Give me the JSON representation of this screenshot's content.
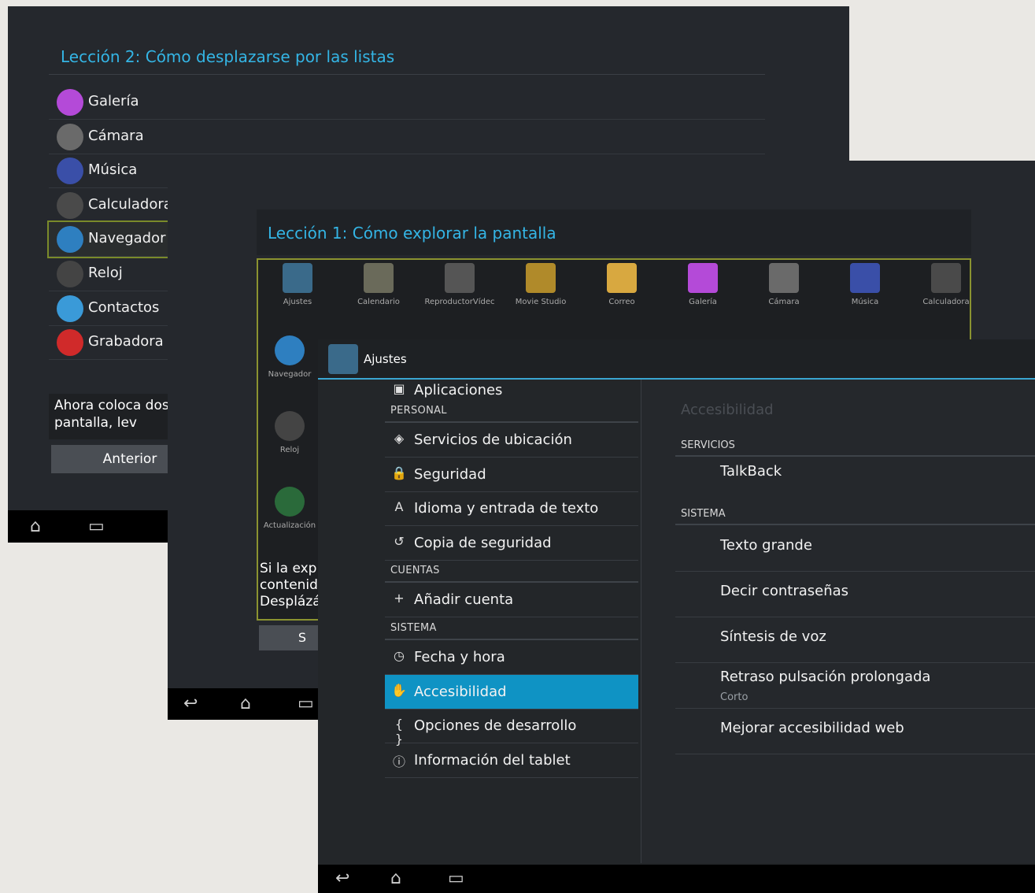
{
  "lesson2": {
    "title": "Lección 2: Cómo desplazarse por las listas",
    "items": [
      {
        "label": "Galería",
        "icon": "gallery-icon",
        "color": "#b44ad8"
      },
      {
        "label": "Cámara",
        "icon": "camera-icon",
        "color": "#6a6a6a"
      },
      {
        "label": "Música",
        "icon": "music-icon",
        "color": "#3a4fa8"
      },
      {
        "label": "Calculadora",
        "icon": "calculator-icon",
        "color": "#4a4a4a"
      },
      {
        "label": "Navegador",
        "icon": "browser-globe-icon",
        "color": "#2e7fc0"
      },
      {
        "label": "Reloj",
        "icon": "clock-icon",
        "color": "#444"
      },
      {
        "label": "Contactos",
        "icon": "contacts-icon",
        "color": "#3a9ad8"
      },
      {
        "label": "Grabadora d",
        "icon": "recorder-icon",
        "color": "#d02a2a"
      }
    ],
    "tip": "Ahora coloca dos de la pantalla, lev",
    "prev_button": "Anterior"
  },
  "lesson1": {
    "title": "Lección 1: Cómo explorar la pantalla",
    "apps_row1": [
      {
        "label": "Ajustes",
        "icon": "settings-icon",
        "color": "#3a6a8a"
      },
      {
        "label": "Calendario",
        "icon": "calendar-icon",
        "color": "#6a6a5a"
      },
      {
        "label": "ReproductorVídec",
        "icon": "video-player-icon",
        "color": "#555"
      },
      {
        "label": "Movie Studio",
        "icon": "clapperboard-icon",
        "color": "#b08a2a"
      },
      {
        "label": "Correo",
        "icon": "email-icon",
        "color": "#d8a840"
      },
      {
        "label": "Galería",
        "icon": "gallery-icon",
        "color": "#b44ad8"
      },
      {
        "label": "Cámara",
        "icon": "camera-icon",
        "color": "#6a6a6a"
      },
      {
        "label": "Música",
        "icon": "music-icon",
        "color": "#3a4fa8"
      },
      {
        "label": "Calculadora",
        "icon": "calculator-icon",
        "color": "#4a4a4a"
      }
    ],
    "apps_col1": [
      {
        "label": "Navegador",
        "icon": "browser-globe-icon",
        "color": "#2e7fc0"
      },
      {
        "label": "Reloj",
        "icon": "clock-icon",
        "color": "#444"
      },
      {
        "label": "Actualización",
        "icon": "update-icon",
        "color": "#2a6a3a"
      }
    ],
    "tip": "Si la exp contenid Desplázá",
    "next_button": "S"
  },
  "settings": {
    "title": "Ajustes",
    "left": {
      "partial_item": "Aplicaciones",
      "sections": [
        {
          "header": "PERSONAL",
          "items": [
            {
              "label": "Servicios de ubicación",
              "icon": "◈",
              "icon_name": "location-icon"
            },
            {
              "label": "Seguridad",
              "icon": "🔒",
              "icon_name": "lock-icon"
            },
            {
              "label": "Idioma y entrada de texto",
              "icon": "A",
              "icon_name": "language-icon"
            },
            {
              "label": "Copia de seguridad",
              "icon": "↺",
              "icon_name": "backup-icon"
            }
          ]
        },
        {
          "header": "CUENTAS",
          "items": [
            {
              "label": "Añadir cuenta",
              "icon": "+",
              "icon_name": "add-icon"
            }
          ]
        },
        {
          "header": "SISTEMA",
          "items": [
            {
              "label": "Fecha y hora",
              "icon": "◷",
              "icon_name": "clock-icon"
            },
            {
              "label": "Accesibilidad",
              "icon": "✋",
              "icon_name": "hand-icon",
              "selected": true
            },
            {
              "label": "Opciones de desarrollo",
              "icon": "{ }",
              "icon_name": "braces-icon"
            },
            {
              "label": "Información del tablet",
              "icon": "ⓘ",
              "icon_name": "info-icon"
            }
          ]
        }
      ]
    },
    "right": {
      "title": "Accesibilidad",
      "services_header": "SERVICIOS",
      "services": [
        "TalkBack"
      ],
      "system_header": "SISTEMA",
      "system": [
        {
          "label": "Texto grande",
          "summary": ""
        },
        {
          "label": "Decir contraseñas",
          "summary": ""
        },
        {
          "label": "Síntesis de voz",
          "summary": ""
        },
        {
          "label": "Retraso pulsación prolongada",
          "summary": "Corto"
        },
        {
          "label": "Mejorar accesibilidad web",
          "summary": ""
        }
      ]
    }
  },
  "colors": {
    "accent": "#34b5e5",
    "selected": "#0f93c4"
  }
}
